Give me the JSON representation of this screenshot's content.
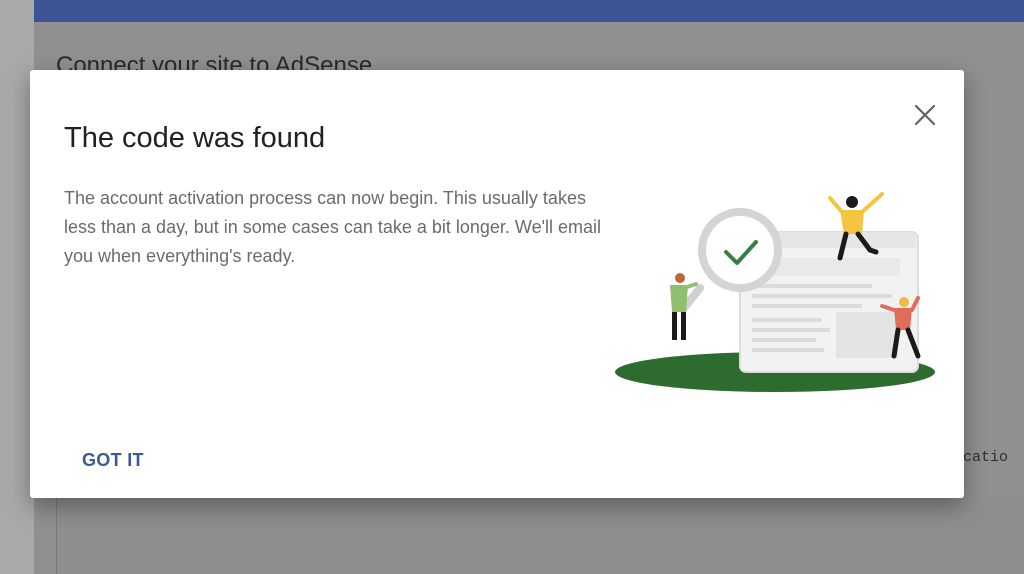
{
  "background": {
    "heading": "Connect your site to AdSense",
    "mono_text": "icatio",
    "topbar_color": "#3d5496"
  },
  "dialog": {
    "title": "The code was found",
    "body": "The account activation process can now begin. This usually takes less than a day, but in some cases can take a bit longer. We'll email you when everything's ready.",
    "close_icon": "close-icon",
    "primary_action_label": "GOT IT",
    "accent_color": "#3b5998"
  },
  "illustration": {
    "icons": [
      "checkmark-icon",
      "magnifier-icon",
      "browser-window-icon"
    ],
    "ground_color": "#2e6b2e",
    "check_color": "#3a7d44"
  }
}
